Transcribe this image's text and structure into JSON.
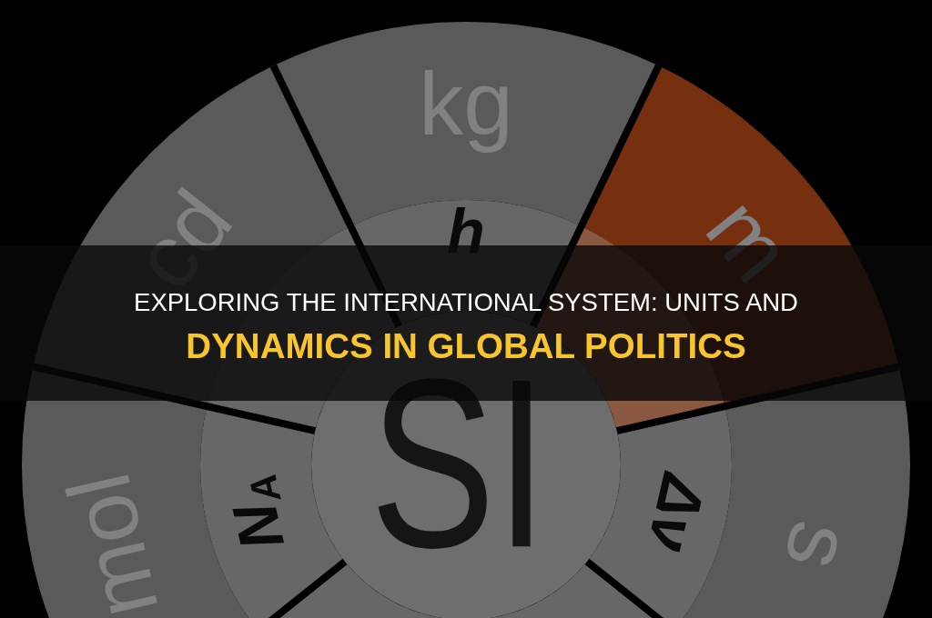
{
  "artwork": {
    "center_label": "SI",
    "segments": [
      {
        "outer": {
          "label": "kg",
          "color": "#5a5a5a"
        },
        "inner": {
          "label": "h",
          "color": "#676767"
        }
      },
      {
        "outer": {
          "label": "m",
          "color": "#76300f"
        },
        "inner": {
          "color": "#8b5841"
        }
      },
      {
        "outer": {
          "label": "s",
          "color": "#5a5a5a"
        },
        "inner": {
          "label": "Δν",
          "color": "#676767"
        }
      },
      {
        "inner": {
          "color": "#676767"
        }
      },
      {
        "inner": {
          "color": "#676767"
        }
      },
      {
        "outer": {
          "label": "mol",
          "color": "#5a5a5a"
        },
        "inner": {
          "label": "N$_{A}$",
          "color": "#676767"
        }
      },
      {
        "outer": {
          "label": "cd",
          "color": "#5a5a5a"
        },
        "inner": {
          "color": "#676767"
        }
      }
    ]
  },
  "banner": {
    "title_lines": [
      {
        "text": "EXPLORING THE INTERNATIONAL SYSTEM: UNITS AND",
        "highlight": false
      },
      {
        "text": "DYNAMICS IN GLOBAL POLITICS",
        "highlight": true
      }
    ]
  }
}
